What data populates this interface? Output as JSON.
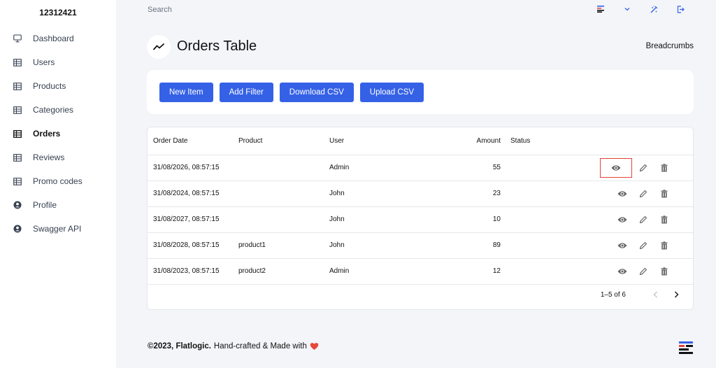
{
  "sidebar": {
    "brand": "12312421",
    "items": [
      {
        "label": "Dashboard",
        "icon": "monitor-icon"
      },
      {
        "label": "Users",
        "icon": "table-icon"
      },
      {
        "label": "Products",
        "icon": "table-icon"
      },
      {
        "label": "Categories",
        "icon": "table-icon"
      },
      {
        "label": "Orders",
        "icon": "table-icon"
      },
      {
        "label": "Reviews",
        "icon": "table-icon"
      },
      {
        "label": "Promo codes",
        "icon": "table-icon"
      },
      {
        "label": "Profile",
        "icon": "user-circle-icon"
      },
      {
        "label": "Swagger API",
        "icon": "user-circle-icon"
      }
    ],
    "active": "Orders"
  },
  "topbar": {
    "search_placeholder": "Search",
    "icons": [
      "menu-lines-icon",
      "chevron-down-icon",
      "theme-toggle-icon",
      "logout-icon"
    ]
  },
  "header": {
    "title": "Orders Table",
    "breadcrumbs": "Breadcrumbs",
    "icon": "chart-line-icon"
  },
  "toolbar": {
    "new_item": "New Item",
    "add_filter": "Add Filter",
    "download_csv": "Download CSV",
    "upload_csv": "Upload CSV"
  },
  "table": {
    "columns": [
      "Order Date",
      "Product",
      "User",
      "Amount",
      "Status"
    ],
    "rows": [
      {
        "date": "31/08/2026, 08:57:15",
        "product": "",
        "user": "Admin",
        "amount": "55",
        "status": ""
      },
      {
        "date": "31/08/2024, 08:57:15",
        "product": "",
        "user": "John",
        "amount": "23",
        "status": ""
      },
      {
        "date": "31/08/2027, 08:57:15",
        "product": "",
        "user": "John",
        "amount": "10",
        "status": ""
      },
      {
        "date": "31/08/2028, 08:57:15",
        "product": "product1",
        "user": "John",
        "amount": "89",
        "status": ""
      },
      {
        "date": "31/08/2023, 08:57:15",
        "product": "product2",
        "user": "Admin",
        "amount": "12",
        "status": ""
      }
    ],
    "pagination": "1–5 of 6"
  },
  "footer": {
    "brand": "©2023, Flatlogic.",
    "text": "Hand-crafted & Made with"
  },
  "colors": {
    "accent": "#3561e6",
    "highlight": "#e0443a",
    "heart": "#e5493a"
  }
}
